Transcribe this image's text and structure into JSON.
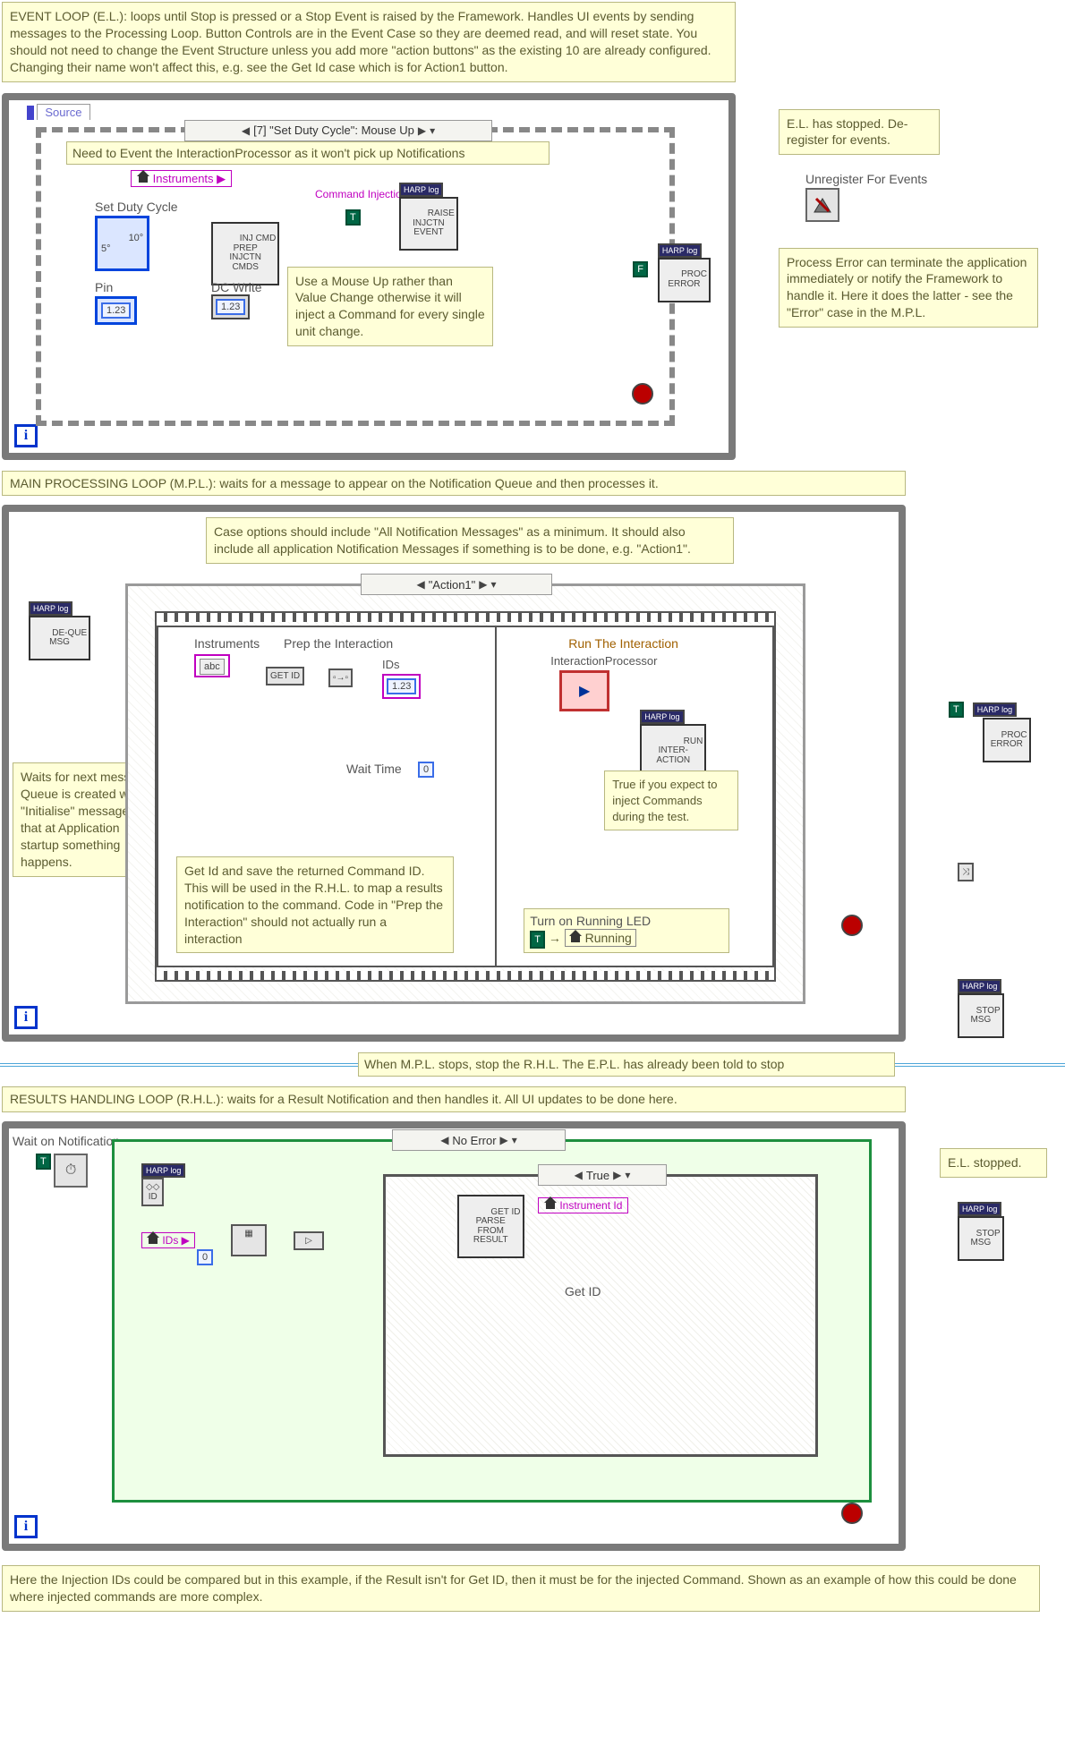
{
  "event_loop": {
    "header_text": "EVENT LOOP (E.L.): loops until Stop is pressed or a Stop Event is raised by the Framework.  Handles UI events by sending messages to the Processing Loop.\nButton Controls are in the Event Case so they are deemed read, and will reset state.  You should not need to change the Event Structure unless you add more \"action buttons\" as the existing 10 are already configured.  Changing their name won't affect this, e.g. see the Get Id case which is for Action1 button.",
    "source_tab": "Source",
    "case_title": "[7] \"Set Duty Cycle\": Mouse Up",
    "interaction_note": "Need to Event the InteractionProcessor as it won't pick up Notifications",
    "instruments_label": "Instruments",
    "set_duty_cycle_label": "Set Duty Cycle",
    "set_duty_cycle_value": "10°\n5°",
    "pin_label": "Pin",
    "pin_value": "1.23",
    "dc_write_label": "DC Write",
    "dc_write_value": "1.23",
    "inj_cmd_box": "INJ CMD\nPREP\nINJCTN\nCMDS",
    "cmd_injection_label": "Command Injection",
    "raise_event_box": "RAISE\nINJCTN\nEVENT",
    "bool_true": "T",
    "bool_false": "F",
    "mouseup_note": "Use a Mouse Up rather than Value Change otherwise it will inject a Command for every single unit change.",
    "proc_error_box": "PROC\nERROR",
    "el_stopped_note": "E.L. has stopped. De-register for events.",
    "unregister_label": "Unregister For Events",
    "process_error_note": "Process Error can terminate the application immediately or notify the Framework to handle it.  Here it does the latter - see the \"Error\" case in the M.P.L."
  },
  "mpl": {
    "header_text": "MAIN PROCESSING LOOP (M.P.L.): waits for a message to appear on the Notification Queue and then processes it.",
    "case_note": "Case options should include \"All Notification Messages\" as a minimum.  It should also include all application Notification Messages if something is to be done, e.g. \"Action1\".",
    "deque_box": "DE-QUE\nMSG",
    "case_title": "\"Action1\"",
    "instruments_label": "Instruments",
    "getid_box": "GET ID",
    "prep_label": "Prep the Interaction",
    "ids_label": "IDs",
    "wait_time_label": "Wait Time",
    "wait_time_value": "0",
    "run_label": "Run The Interaction",
    "iproc_label": "InteractionProcessor",
    "run_inter_box": "RUN\nINTER-\nACTION",
    "inject_note": "True if you expect to inject Commands during the test.",
    "turn_on_led_label": "Turn on Running LED",
    "running_label": "Running",
    "getid_note": "Get Id and save the returned Command ID.  This will be used in the R.H.L. to map a results notification to the command.  Code in \"Prep the Interaction\" should not actually run a interaction",
    "waits_note": "Waits for next message.  Queue is created with \"Initialise\" message so that at Application startup something happens.",
    "stop_msg_box": "STOP\nMSG",
    "proc_error_box": "PROC\nERROR",
    "bool_true": "T"
  },
  "divider_note": "When M.P.L. stops, stop the R.H.L.  The E.P.L. has already been told to stop",
  "rhl": {
    "header_text": "RESULTS HANDLING LOOP (R.H.L.): waits for a Result Notification and then handles it.  All UI updates to be done here.",
    "wait_notif_label": "Wait on Notification",
    "id_label": "ID",
    "ids_label": "IDs",
    "zero": "0",
    "case_title": "No Error",
    "inner_case_title": "True",
    "getid_parse_box": "GET ID\nPARSE\nFROM\nRESULT",
    "instrument_id_label": "Instrument Id",
    "getid_label": "Get ID",
    "bool_true": "T",
    "el_stopped_note": "E.L. stopped.",
    "stop_msg_box": "STOP\nMSG"
  },
  "footer_note": "Here the Injection IDs could be compared but in this example, if the Result isn't for Get ID, then it must be for the injected Command.  Shown as an example of how this could be done where injected commands are more complex.",
  "harp_label": "HARP log"
}
